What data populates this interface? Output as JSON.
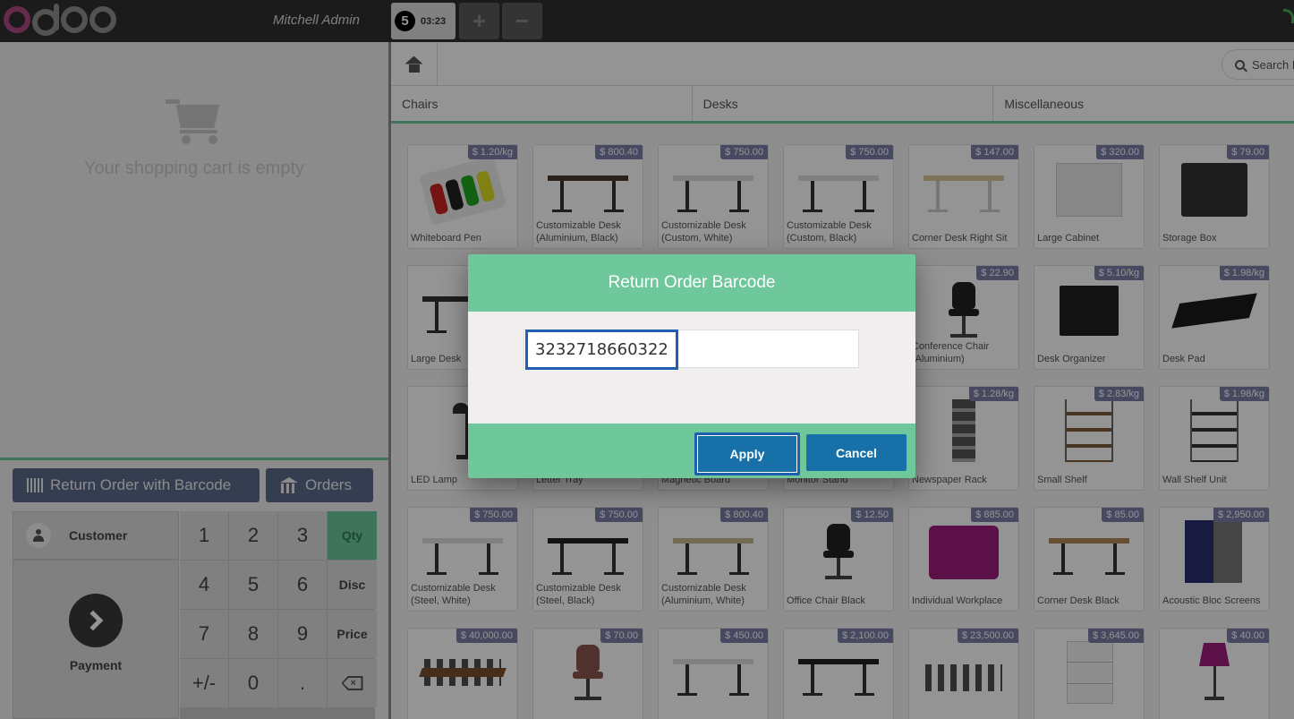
{
  "header": {
    "logo_text": "odoo",
    "cashier": "Mitchell Admin",
    "order_number": "5",
    "order_time": "03:23",
    "add_order_label": "+",
    "remove_order_label": "−"
  },
  "cart": {
    "empty_message": "Your shopping cart is empty"
  },
  "controls": {
    "return_barcode_label": "Return Order with Barcode",
    "orders_label": "Orders"
  },
  "actionpad": {
    "customer_label": "Customer",
    "payment_label": "Payment"
  },
  "numpad": {
    "keys": [
      "1",
      "2",
      "3",
      "Qty",
      "4",
      "5",
      "6",
      "Disc",
      "7",
      "8",
      "9",
      "Price",
      "+/-",
      "0",
      "."
    ],
    "active_mode": "Qty"
  },
  "search": {
    "placeholder": "Search I"
  },
  "categories": [
    "Chairs",
    "Desks",
    "Miscellaneous"
  ],
  "products": [
    {
      "name": "Whiteboard Pen",
      "price": "$ 1.20/kg"
    },
    {
      "name": "Customizable Desk (Aluminium, Black)",
      "price": "$ 800.40"
    },
    {
      "name": "Customizable Desk (Custom, White)",
      "price": "$ 750.00"
    },
    {
      "name": "Customizable Desk (Custom, Black)",
      "price": "$ 750.00"
    },
    {
      "name": "Corner Desk Right Sit",
      "price": "$ 147.00"
    },
    {
      "name": "Large Cabinet",
      "price": "$ 320.00"
    },
    {
      "name": "Storage Box",
      "price": "$ 79.00"
    },
    {
      "name": "Large Desk",
      "price": "$"
    },
    {
      "name": "",
      "price": ""
    },
    {
      "name": "",
      "price": ""
    },
    {
      "name": "",
      "price": ""
    },
    {
      "name": "Conference Chair (Aluminium)",
      "price": "$ 22.90"
    },
    {
      "name": "Desk Organizer",
      "price": "$ 5.10/kg"
    },
    {
      "name": "Desk Pad",
      "price": "$ 1.98/kg"
    },
    {
      "name": "LED Lamp",
      "price": "$"
    },
    {
      "name": "Letter Tray",
      "price": ""
    },
    {
      "name": "Magnetic Board",
      "price": ""
    },
    {
      "name": "Monitor Stand",
      "price": ""
    },
    {
      "name": "Newspaper Rack",
      "price": "$ 1.28/kg"
    },
    {
      "name": "Small Shelf",
      "price": "$ 2.83/kg"
    },
    {
      "name": "Wall Shelf Unit",
      "price": "$ 1.98/kg"
    },
    {
      "name": "Customizable Desk (Steel, White)",
      "price": "$ 750.00"
    },
    {
      "name": "Customizable Desk (Steel, Black)",
      "price": "$ 750.00"
    },
    {
      "name": "Customizable Desk (Aluminium, White)",
      "price": "$ 800.40"
    },
    {
      "name": "Office Chair Black",
      "price": "$ 12.50"
    },
    {
      "name": "Individual Workplace",
      "price": "$ 885.00"
    },
    {
      "name": "Corner Desk Black",
      "price": "$ 85.00"
    },
    {
      "name": "Acoustic Bloc Screens",
      "price": "$ 2,950.00"
    },
    {
      "name": "",
      "price": "$ 40,000.00"
    },
    {
      "name": "",
      "price": "$ 70.00"
    },
    {
      "name": "",
      "price": "$ 450.00"
    },
    {
      "name": "",
      "price": "$ 2,100.00"
    },
    {
      "name": "",
      "price": "$ 23,500.00"
    },
    {
      "name": "",
      "price": "$ 3,645.00"
    },
    {
      "name": "",
      "price": "$ 40.00"
    }
  ],
  "modal": {
    "title": "Return Order Barcode",
    "barcode_value": "3232718660322",
    "apply_label": "Apply",
    "cancel_label": "Cancel"
  },
  "colors": {
    "accent_green": "#6ec89b",
    "button_blue": "#1770a8",
    "focus_blue": "#1e5faf",
    "price_tag": "#7b7fa8",
    "control_button": "#5a6c8a"
  }
}
